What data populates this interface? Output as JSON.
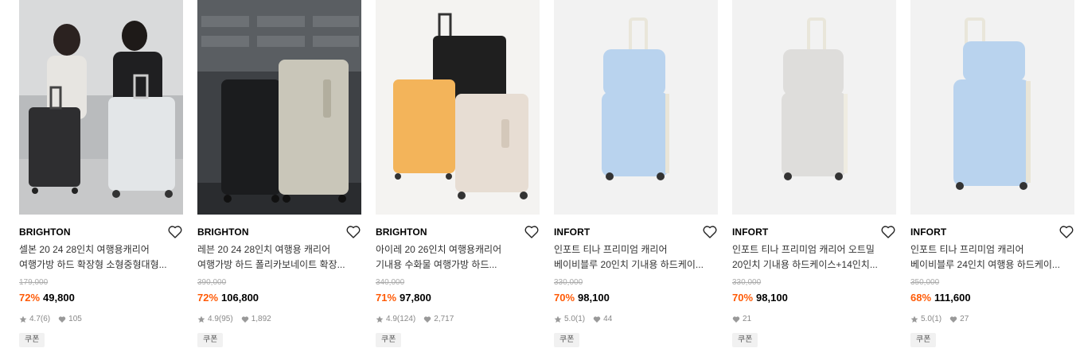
{
  "products": [
    {
      "brand": "BRIGHTON",
      "title_line1": "셀본 20 24 28인치 여행용캐리어",
      "title_line2": "여행가방 하드 확장형 소형중형대형...",
      "original_price": "179,000",
      "discount": "72%",
      "price": "49,800",
      "rating": "4.7",
      "reviews": "(6)",
      "likes": "105",
      "coupon": "쿠폰",
      "image_icon": "luggage-photo-couple"
    },
    {
      "brand": "BRIGHTON",
      "title_line1": "레븐 20 24 28인치 여행용 캐리어",
      "title_line2": "여행가방 하드 폴리카보네이트 확장...",
      "original_price": "390,000",
      "discount": "72%",
      "price": "106,800",
      "rating": "4.9",
      "reviews": "(95)",
      "likes": "1,892",
      "coupon": "쿠폰",
      "image_icon": "luggage-photo-black-beige"
    },
    {
      "brand": "BRIGHTON",
      "title_line1": "아이레 20 26인치 여행용캐리어",
      "title_line2": "기내용 수화물 여행가방 하드...",
      "original_price": "340,000",
      "discount": "71%",
      "price": "97,800",
      "rating": "4.9",
      "reviews": "(124)",
      "likes": "2,717",
      "coupon": "쿠폰",
      "image_icon": "luggage-photo-three"
    },
    {
      "brand": "INFORT",
      "title_line1": "인포트 티나 프리미엄 캐리어",
      "title_line2": "베이비블루 20인치 기내용 하드케이...",
      "original_price": "330,000",
      "discount": "70%",
      "price": "98,100",
      "rating": "5.0",
      "reviews": "(1)",
      "likes": "44",
      "coupon": "쿠폰",
      "image_icon": "luggage-photo-blue-set"
    },
    {
      "brand": "INFORT",
      "title_line1": "인포트 티나 프리미엄 캐리어 오트밀",
      "title_line2": "20인치 기내용 하드케이스+14인치...",
      "original_price": "330,000",
      "discount": "70%",
      "price": "98,100",
      "rating": "",
      "reviews": "",
      "likes": "21",
      "coupon": "쿠폰",
      "image_icon": "luggage-photo-oatmeal-set"
    },
    {
      "brand": "INFORT",
      "title_line1": "인포트 티나 프리미엄 캐리어",
      "title_line2": "베이비블루 24인치 여행용 하드케이...",
      "original_price": "350,000",
      "discount": "68%",
      "price": "111,600",
      "rating": "5.0",
      "reviews": "(1)",
      "likes": "27",
      "coupon": "쿠폰",
      "image_icon": "luggage-photo-blue-24"
    }
  ],
  "colors": {
    "discount": "#ff5b07",
    "muted": "#888888",
    "coupon_bg": "#f1f1f1"
  }
}
